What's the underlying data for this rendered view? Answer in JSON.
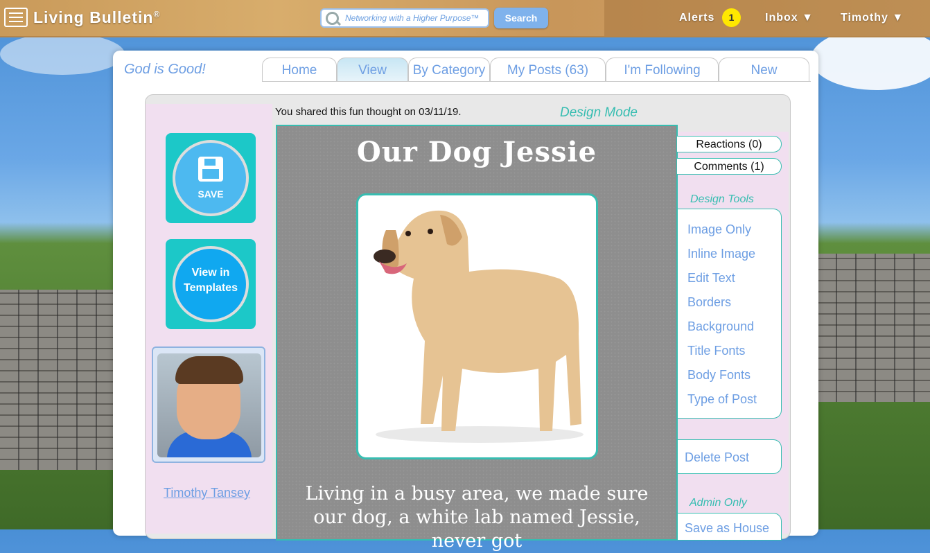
{
  "header": {
    "brand": "Living Bulletin",
    "brand_mark": "®",
    "search_placeholder": "Networking with a Higher Purpose™",
    "search_button": "Search",
    "alerts_label": "Alerts",
    "alerts_count": "1",
    "inbox_label": "Inbox ▼",
    "user_label": "Timothy ▼"
  },
  "motto": "God is Good!",
  "tabs": [
    {
      "label": "Home"
    },
    {
      "label": "View"
    },
    {
      "label": "By Category"
    },
    {
      "label": "My Posts (63)"
    },
    {
      "label": "I'm Following"
    },
    {
      "label": "New"
    }
  ],
  "active_tab": "View",
  "post_meta": {
    "shared_text": "You shared this fun thought on 03/11/19.",
    "mode": "Design Mode"
  },
  "left": {
    "save_label": "SAVE",
    "templates_label_1": "View in",
    "templates_label_2": "Templates",
    "user_name": "Timothy Tansey"
  },
  "post": {
    "title": "Our Dog Jessie",
    "body": "Living in a busy area, we made sure our dog, a white lab named Jessie, never got"
  },
  "right": {
    "reactions": "Reactions (0)",
    "comments": "Comments (1)",
    "design_tools_title": "Design Tools",
    "tools": [
      "Image Only",
      "Inline Image",
      "Edit Text",
      "Borders",
      "Background",
      "Title Fonts",
      "Body Fonts",
      "Type of Post"
    ],
    "delete": "Delete Post",
    "admin_title": "Admin Only",
    "admin_action": "Save as House"
  },
  "colors": {
    "accent_teal": "#37bdb1",
    "link_blue": "#6d9ee3",
    "alert_badge": "#ffe800"
  }
}
